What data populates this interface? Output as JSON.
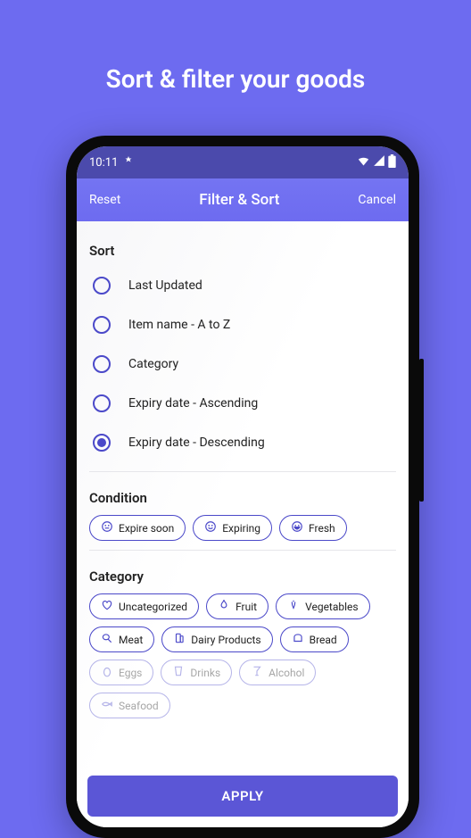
{
  "page": {
    "title": "Sort & filter your goods"
  },
  "status": {
    "time": "10:11"
  },
  "header": {
    "reset": "Reset",
    "title": "Filter & Sort",
    "cancel": "Cancel"
  },
  "sort": {
    "title": "Sort",
    "items": [
      {
        "label": "Last Updated",
        "selected": false
      },
      {
        "label": "Item name - A to Z",
        "selected": false
      },
      {
        "label": "Category",
        "selected": false
      },
      {
        "label": "Expiry date - Ascending",
        "selected": false
      },
      {
        "label": "Expiry date - Descending",
        "selected": true
      }
    ]
  },
  "condition": {
    "title": "Condition",
    "items": [
      {
        "label": "Expire soon",
        "icon": "face-neutral"
      },
      {
        "label": "Expiring",
        "icon": "face-smile"
      },
      {
        "label": "Fresh",
        "icon": "face-grin"
      }
    ]
  },
  "category": {
    "title": "Category",
    "items": [
      {
        "label": "Uncategorized",
        "icon": "heart"
      },
      {
        "label": "Fruit",
        "icon": "flame"
      },
      {
        "label": "Vegetables",
        "icon": "veg"
      },
      {
        "label": "Meat",
        "icon": "meat"
      },
      {
        "label": "Dairy Products",
        "icon": "dairy"
      },
      {
        "label": "Bread",
        "icon": "bread"
      }
    ],
    "items_faded": [
      {
        "label": "Eggs",
        "icon": "egg"
      },
      {
        "label": "Drinks",
        "icon": "drink"
      },
      {
        "label": "Alcohol",
        "icon": "alcohol"
      },
      {
        "label": "Seafood",
        "icon": "fish"
      }
    ]
  },
  "apply": {
    "label": "APPLY"
  }
}
